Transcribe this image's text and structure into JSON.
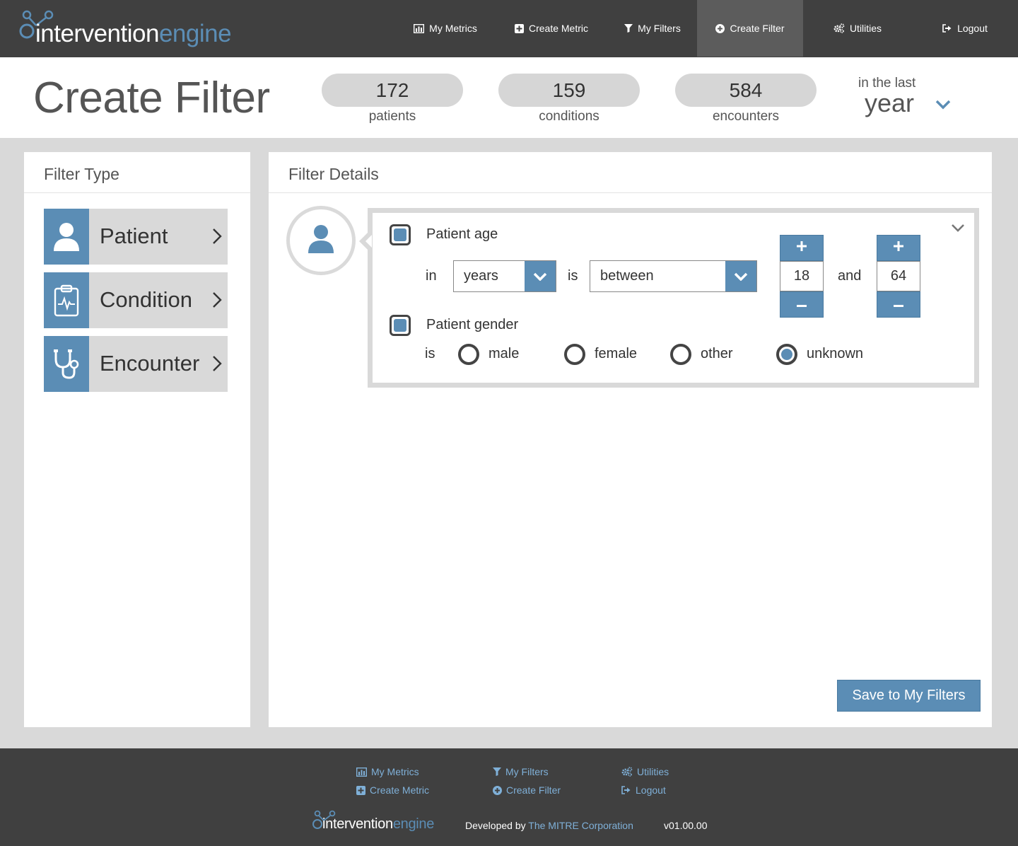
{
  "brand": {
    "part1": "intervention",
    "part2": "engine"
  },
  "nav": [
    {
      "label": "My Metrics",
      "icon": "bar-chart-icon"
    },
    {
      "label": "Create Metric",
      "icon": "plus-square-icon"
    },
    {
      "label": "My Filters",
      "icon": "filter-icon"
    },
    {
      "label": "Create Filter",
      "icon": "plus-circle-icon",
      "active": true
    },
    {
      "label": "Utilities",
      "icon": "gears-icon"
    },
    {
      "label": "Logout",
      "icon": "logout-icon"
    }
  ],
  "page": {
    "title": "Create Filter"
  },
  "stats": [
    {
      "value": "172",
      "label": "patients"
    },
    {
      "value": "159",
      "label": "conditions"
    },
    {
      "value": "584",
      "label": "encounters"
    }
  ],
  "period": {
    "prefix": "in the last",
    "value": "year"
  },
  "filter_type": {
    "heading": "Filter Type",
    "items": [
      {
        "label": "Patient",
        "icon": "user-icon"
      },
      {
        "label": "Condition",
        "icon": "clipboard-pulse-icon"
      },
      {
        "label": "Encounter",
        "icon": "stethoscope-icon"
      }
    ]
  },
  "filter_details": {
    "heading": "Filter Details",
    "age": {
      "label": "Patient age",
      "checked": true,
      "in_label": "in",
      "unit": "years",
      "is_label": "is",
      "operator": "between",
      "min": "18",
      "and_label": "and",
      "max": "64"
    },
    "gender": {
      "label": "Patient gender",
      "checked": true,
      "is_label": "is",
      "options": [
        "male",
        "female",
        "other",
        "unknown"
      ],
      "selected": "unknown"
    },
    "save_label": "Save to My Filters"
  },
  "footer": {
    "links": [
      {
        "label": "My Metrics",
        "icon": "bar-chart-icon"
      },
      {
        "label": "Create Metric",
        "icon": "plus-square-icon"
      },
      {
        "label": "My Filters",
        "icon": "filter-icon"
      },
      {
        "label": "Create Filter",
        "icon": "plus-circle-icon"
      },
      {
        "label": "Utilities",
        "icon": "gears-icon"
      },
      {
        "label": "Logout",
        "icon": "logout-icon"
      }
    ],
    "developed_by": "Developed by",
    "company": "The MITRE Corporation",
    "version": "v01.00.00"
  },
  "colors": {
    "accent": "#5b8db5",
    "header_bg": "#404040",
    "panel_bg": "#d9d9d9"
  }
}
